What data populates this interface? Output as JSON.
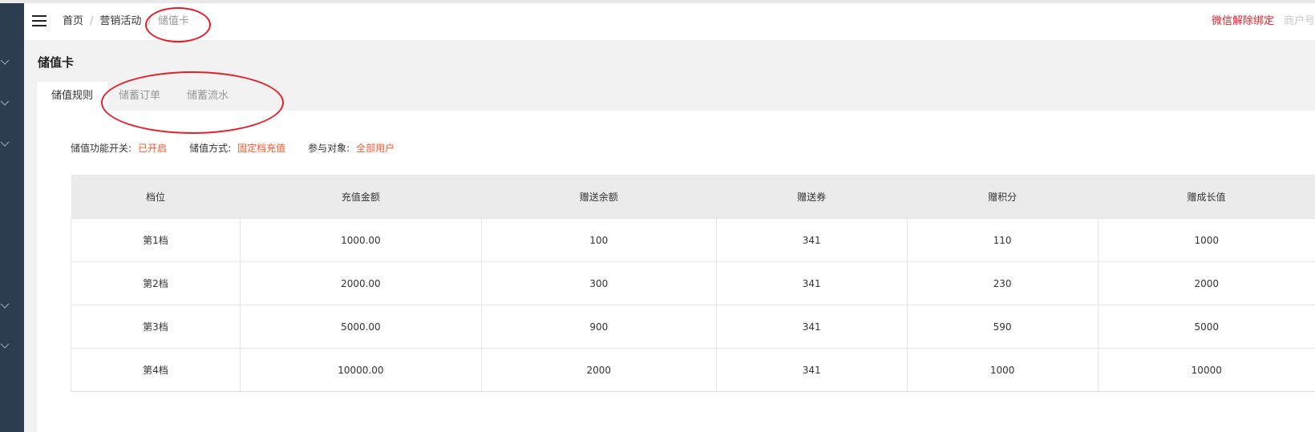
{
  "breadcrumb": {
    "items": [
      "首页",
      "营销活动",
      "储值卡"
    ],
    "separator": "/"
  },
  "header": {
    "unbind_label": "微信解除绑定",
    "merchant_label": "商户号"
  },
  "page": {
    "title": "储值卡"
  },
  "tabs": [
    {
      "label": "储值规则",
      "active": true
    },
    {
      "label": "储蓄订单",
      "active": false
    },
    {
      "label": "储蓄流水",
      "active": false
    }
  ],
  "settings": {
    "switch_label": "储值功能开关:",
    "switch_value": "已开启",
    "mode_label": "储值方式:",
    "mode_value": "固定档充值",
    "target_label": "参与对象:",
    "target_value": "全部用户"
  },
  "table": {
    "headers": [
      "档位",
      "充值金额",
      "赠送余额",
      "赠送券",
      "赠积分",
      "赠成长值"
    ],
    "rows": [
      [
        "第1档",
        "1000.00",
        "100",
        "341",
        "110",
        "1000"
      ],
      [
        "第2档",
        "2000.00",
        "300",
        "341",
        "230",
        "2000"
      ],
      [
        "第3档",
        "5000.00",
        "900",
        "341",
        "590",
        "5000"
      ],
      [
        "第4档",
        "10000.00",
        "2000",
        "341",
        "1000",
        "10000"
      ]
    ]
  },
  "colors": {
    "sidebar": "#2b3d4f",
    "accent_red": "#e0202b",
    "value_orange": "#f5572b"
  },
  "icons": {
    "menu": "hamburger-icon",
    "sidebar_expand": "chevron-down-icon"
  }
}
